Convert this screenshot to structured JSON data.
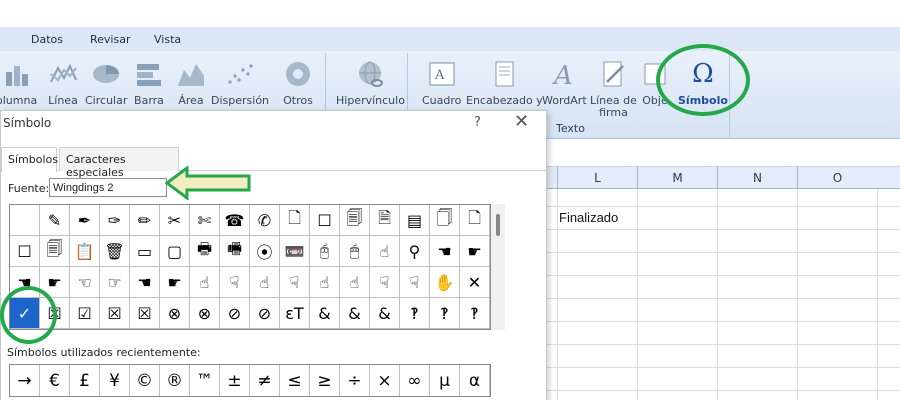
{
  "menu": {
    "items": [
      "Datos",
      "Revisar",
      "Vista"
    ]
  },
  "ribbon": {
    "charts": [
      "olumna",
      "Línea",
      "Circular",
      "Barra",
      "Área",
      "Dispersión",
      "Otros"
    ],
    "links": [
      "Hipervínculo"
    ],
    "text": [
      "Cuadro",
      "Encabezado y",
      "WordArt",
      "Línea de",
      "firma",
      "Obje",
      "Símbolo"
    ],
    "text_group_label": "Texto"
  },
  "sheet": {
    "columns": [
      "L",
      "M",
      "N",
      "O"
    ],
    "cell_value": "Finalizado"
  },
  "dialog": {
    "title": "Símbolo",
    "help": "?",
    "close": "✕",
    "tab_symbols": "Símbolos",
    "tab_special": "Caracteres especiales",
    "font_label": "Fuente:",
    "font_value": "Wingdings 2",
    "rows": [
      [
        "",
        "✎",
        "✒",
        "✑",
        "✏",
        "✂",
        "✄",
        "☎",
        "✆",
        "🗋",
        "☐",
        "🗐",
        "🗎",
        "▤",
        "🗍",
        "🗋"
      ],
      [
        "☐",
        "🗐",
        "📋",
        "🗑",
        "▭",
        "▢",
        "🖶",
        "🖷",
        "⦿",
        "📼",
        "🖰",
        "🖱",
        "☝",
        "⚲",
        "☚",
        "☛"
      ],
      [
        "☚",
        "☛",
        "☜",
        "☞",
        "☚",
        "☛",
        "☝",
        "☟",
        "☝",
        "☟",
        "☝",
        "☝",
        "☟",
        "☟",
        "✋",
        "✕"
      ],
      [
        "✓",
        "☒",
        "☑",
        "☒",
        "☒",
        "⊗",
        "⊗",
        "⊘",
        "⊘",
        "ɛT",
        "&",
        "&",
        "&",
        "‽",
        "‽",
        "‽"
      ]
    ],
    "recent_label": "Símbolos utilizados recientemente:",
    "recent": [
      "→",
      "€",
      "£",
      "¥",
      "©",
      "®",
      "™",
      "±",
      "≠",
      "≤",
      "≥",
      "÷",
      "×",
      "∞",
      "µ",
      "α"
    ]
  },
  "colors": {
    "annotation": "#23a84a",
    "selected": "#1c66c9",
    "ribbon_accent": "#1d4d9b"
  }
}
